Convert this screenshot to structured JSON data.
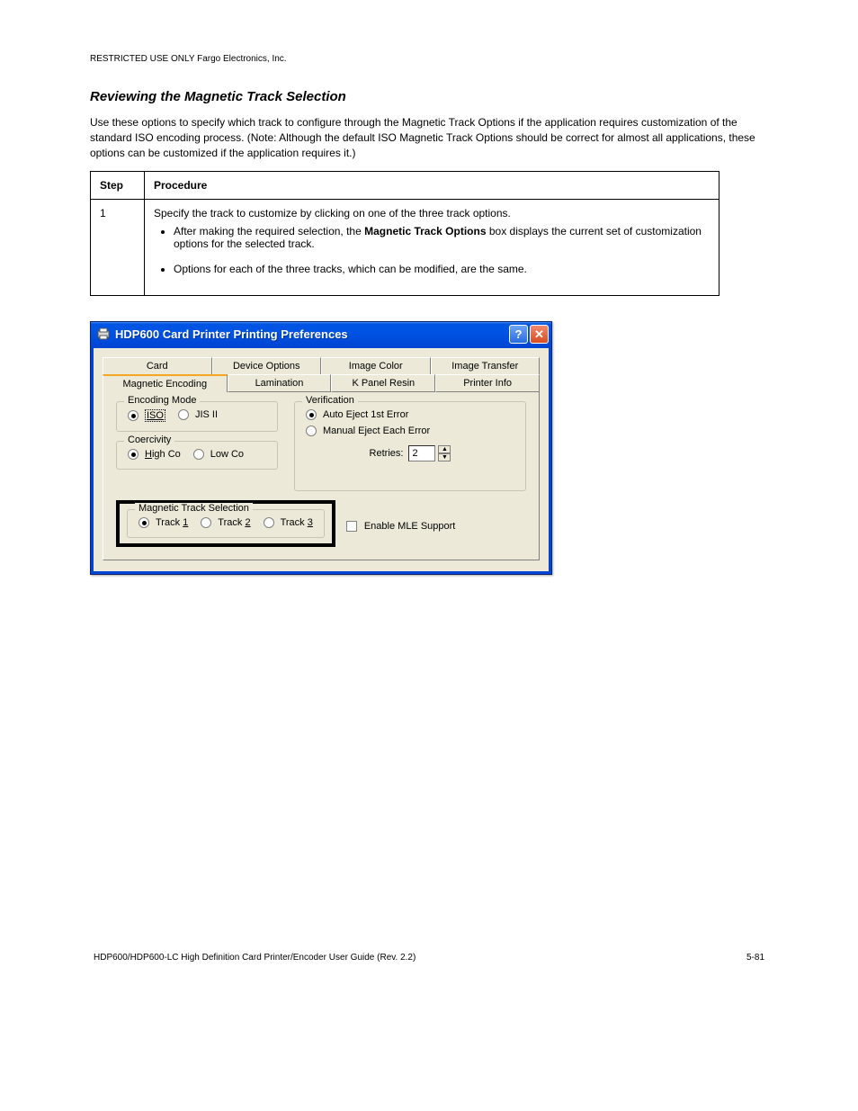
{
  "header_text": "RESTRICTED USE ONLY                                                                  Fargo Electronics, Inc.",
  "section_title": "Reviewing the Magnetic Track Selection",
  "paragraph": "Use these options to specify which track to configure through the Magnetic Track Options if the application requires customization of the standard ISO encoding process. (Note: Although the default ISO Magnetic Track Options should be correct for almost all applications, these options can be customized if the application requires it.)",
  "table": {
    "headers": [
      "Step",
      "Procedure"
    ],
    "step_value": "1",
    "proc_intro": "Specify the track to customize by clicking on one of the three track options.",
    "bullet1_prefix": "After making the required selection, the ",
    "bullet1_bold": "Magnetic Track Options",
    "bullet1_suffix": " box displays the current set of customization options for the selected track.",
    "bullet2": "Options for each of the three tracks, which can be modified, are the same."
  },
  "dialog": {
    "title": "HDP600 Card Printer Printing Preferences",
    "help_glyph": "?",
    "close_glyph": "✕",
    "tabs_row1": [
      "Card",
      "Device Options",
      "Image Color",
      "Image Transfer"
    ],
    "tabs_row2": [
      "Magnetic Encoding",
      "Lamination",
      "K Panel Resin",
      "Printer Info"
    ],
    "active_tab": "Magnetic Encoding",
    "encoding_mode": {
      "legend": "Encoding Mode",
      "iso": "ISO",
      "jis": "JIS II"
    },
    "coercivity": {
      "legend": "Coercivity",
      "high": "High Co",
      "low": "Low Co"
    },
    "verification": {
      "legend": "Verification",
      "auto": "Auto Eject 1st Error",
      "manual": "Manual Eject Each Error",
      "retries_label": "Retries:",
      "retries_value": "2"
    },
    "track_selection": {
      "legend": "Magnetic Track Selection",
      "t1": "Track ",
      "t2": "Track ",
      "t3": "Track ",
      "n1": "1",
      "n2": "2",
      "n3": "3"
    },
    "mle_label": "Enable MLE Support"
  },
  "footer": {
    "left": "HDP600/HDP600-LC High Definition Card Printer/Encoder User Guide (Rev. 2.2)",
    "right": "5-81"
  }
}
